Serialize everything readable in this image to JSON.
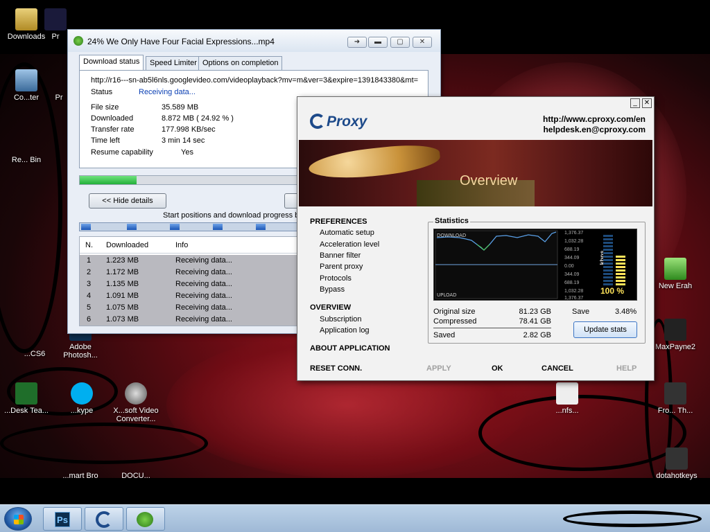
{
  "desktop": {
    "icons": [
      {
        "label": "Downloads",
        "icon": "folder-icon"
      },
      {
        "label": "Pr",
        "icon": "app-icon"
      },
      {
        "label": "Co...ter",
        "icon": "computer-icon"
      },
      {
        "label": "Pr",
        "icon": "app-icon"
      },
      {
        "label": "Re... Bin",
        "icon": "recycle-bin-icon"
      },
      {
        "label": "Adobe Photosh...",
        "icon": "photoshop-icon"
      },
      {
        "label": "...CS6",
        "icon": "photoshop-icon"
      },
      {
        "label": "...Desk Tea...",
        "icon": "app-icon"
      },
      {
        "label": "...kype",
        "icon": "skype-icon"
      },
      {
        "label": "X...soft Video Converter...",
        "icon": "video-converter-icon"
      },
      {
        "label": "New Erah",
        "icon": "app-icon"
      },
      {
        "label": "MaxPayne2",
        "icon": "game-icon"
      },
      {
        "label": "...nfs...",
        "icon": "game-icon"
      },
      {
        "label": "Fro... Th...",
        "icon": "game-icon"
      },
      {
        "label": "...mart Bro",
        "icon": "app-icon"
      },
      {
        "label": "DOCU...",
        "icon": "app-icon"
      },
      {
        "label": "dotahotkeys",
        "icon": "app-icon"
      }
    ]
  },
  "idm": {
    "title": "24% We Only Have Four Facial Expressions...mp4",
    "tabs": [
      "Download status",
      "Speed Limiter",
      "Options on completion"
    ],
    "url": "http://r16---sn-ab5l6nls.googlevideo.com/videoplayback?mv=m&ver=3&expire=1391843380&mt=13918",
    "status_label": "Status",
    "status_value": "Receiving data...",
    "fields": [
      {
        "label": "File size",
        "value": "35.589  MB"
      },
      {
        "label": "Downloaded",
        "value": "8.872  MB  ( 24.92 % )"
      },
      {
        "label": "Transfer rate",
        "value": "177.998  KB/sec"
      },
      {
        "label": "Time left",
        "value": "3 min 14 sec"
      },
      {
        "label": "Resume capability",
        "value": "Yes"
      }
    ],
    "progress_percent": 24.92,
    "hide_details": "<< Hide details",
    "start_positions_text": "Start positions and download progress b",
    "list_headers": [
      "N.",
      "Downloaded",
      "Info"
    ],
    "rows": [
      {
        "n": "1",
        "downloaded": "1.223  MB",
        "info": "Receiving data..."
      },
      {
        "n": "2",
        "downloaded": "1.172  MB",
        "info": "Receiving data..."
      },
      {
        "n": "3",
        "downloaded": "1.135  MB",
        "info": "Receiving data..."
      },
      {
        "n": "4",
        "downloaded": "1.091  MB",
        "info": "Receiving data..."
      },
      {
        "n": "5",
        "downloaded": "1.075  MB",
        "info": "Receiving data..."
      },
      {
        "n": "6",
        "downloaded": "1.073  MB",
        "info": "Receiving data..."
      }
    ]
  },
  "cproxy": {
    "logo": "Proxy",
    "url": "http://www.cproxy.com/en",
    "email": "helpdesk.en@cproxy.com",
    "banner_title": "Overview",
    "preferences_header": "PREFERENCES",
    "preferences": [
      "Automatic setup",
      "Acceleration level",
      "Banner filter",
      "Parent proxy",
      "Protocols",
      "Bypass"
    ],
    "overview_header": "OVERVIEW",
    "overview": [
      "Subscription",
      "Application log"
    ],
    "about": "ABOUT APPLICATION",
    "statistics_title": "Statistics",
    "graph_download": "DOWNLOAD",
    "graph_upload": "UPLOAD",
    "graph_ticks": [
      "1,376.37",
      "1,032.28",
      "688.19",
      "344.09",
      "0.00",
      "344.09",
      "688.19",
      "1,032.28",
      "1,376.37"
    ],
    "graph_unit": "kbps",
    "graph_percent": "100  %",
    "original_size_label": "Original size",
    "original_size_value": "81.23 GB",
    "compressed_label": "Compressed",
    "compressed_value": "78.41 GB",
    "saved_label": "Saved",
    "saved_value": "2.82 GB",
    "save_label": "Save",
    "save_value": "3.48%",
    "update_stats": "Update stats",
    "footer": {
      "reset": "RESET CONN.",
      "apply": "APPLY",
      "ok": "OK",
      "cancel": "CANCEL",
      "help": "HELP"
    }
  },
  "taskbar": {
    "buttons": [
      "photoshop",
      "cproxy",
      "internet-download-manager"
    ]
  }
}
